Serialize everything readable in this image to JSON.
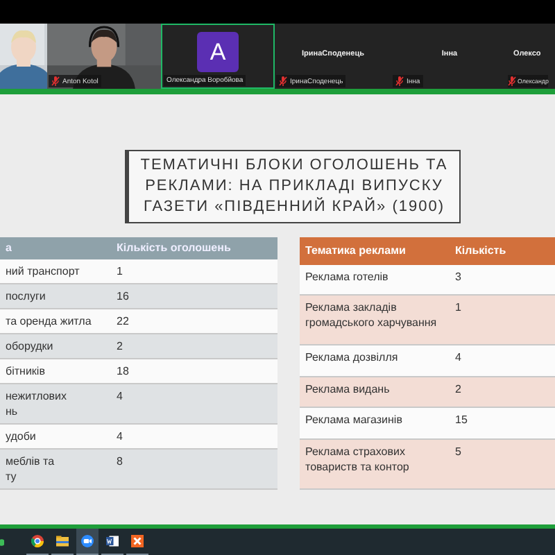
{
  "gallery": [
    {
      "kind": "video",
      "selected": false
    },
    {
      "kind": "video",
      "name": "Anton Kotol",
      "muted": true,
      "selected": false
    },
    {
      "kind": "avatar",
      "letter": "A",
      "name": "Олександра Воробйова",
      "muted": false,
      "selected": true
    },
    {
      "kind": "name",
      "display_name": "ІринаСподенець",
      "name": "ІринаСподенець",
      "muted": true,
      "selected": false
    },
    {
      "kind": "name",
      "display_name": "Інна",
      "name": "Інна",
      "muted": true,
      "selected": false
    },
    {
      "kind": "name",
      "display_name": "Олексо",
      "name": "Олександр",
      "muted": true,
      "selected": false
    }
  ],
  "slide": {
    "title": "ТЕМАТИЧНІ БЛОКИ ОГОЛОШЕНЬ ТА РЕКЛАМИ: НА ПРИКЛАДІ ВИПУСКУ ГАЗЕТИ «ПІВДЕННИЙ КРАЙ» (1900)",
    "tables": [
      {
        "kind": "gray",
        "columns": [
          "а",
          "Кількість оголошень"
        ],
        "rows": [
          [
            "ний транспорт",
            "1"
          ],
          [
            "послуги",
            "16"
          ],
          [
            "та оренда житла",
            "22"
          ],
          [
            "оборудки",
            "2"
          ],
          [
            "бітників",
            "18"
          ],
          [
            "нежитлових\nнь",
            "4"
          ],
          [
            "удоби",
            "4"
          ],
          [
            "меблів та\nту",
            "8"
          ]
        ]
      },
      {
        "kind": "orange",
        "columns": [
          "Тематика реклами",
          "Кількість"
        ],
        "rows": [
          [
            "Реклама готелів",
            "3"
          ],
          [
            "Реклама закладів громадського харчування",
            "1"
          ],
          [
            "Реклама дозвілля",
            "4"
          ],
          [
            "Реклама видань",
            "2"
          ],
          [
            "Реклама магазинів",
            "15"
          ],
          [
            "Реклама страхових товариств та контор",
            "5"
          ]
        ]
      }
    ]
  },
  "taskbar": [
    {
      "kind": "messenger",
      "selected": false
    },
    {
      "kind": "browser",
      "selected": false
    },
    {
      "kind": "folder",
      "selected": false
    },
    {
      "kind": "meeting",
      "selected": true
    },
    {
      "kind": "word",
      "selected": false
    },
    {
      "kind": "tool",
      "selected": false
    }
  ]
}
